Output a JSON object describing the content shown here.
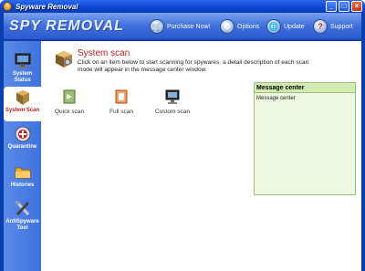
{
  "window": {
    "title": "Spyware Removal",
    "app_icon_glyph": "S",
    "minimize": "_",
    "maximize": "□",
    "close": "×"
  },
  "header": {
    "logo": "SPY REMOVAL",
    "buttons": [
      {
        "label": "Purchase Now!",
        "icon": "cart-icon"
      },
      {
        "label": "Options",
        "icon": "options-icon"
      },
      {
        "label": "Update",
        "icon": "update-icon"
      },
      {
        "label": "Support",
        "icon": "help-icon"
      }
    ]
  },
  "sidebar": {
    "items": [
      {
        "label": "System Status",
        "icon": "monitor-icon",
        "active": false
      },
      {
        "label": "System Scan",
        "icon": "scan-icon",
        "active": true
      },
      {
        "label": "Quarantine",
        "icon": "quarantine-icon",
        "active": false
      },
      {
        "label": "Histories",
        "icon": "folder-icon",
        "active": false
      },
      {
        "label": "AntiSpyware Tool",
        "icon": "tools-icon",
        "active": false
      }
    ]
  },
  "main": {
    "title": "System scan",
    "description": "Click on an item below to start scanning for spywares. a detail description of each scan mode will appear in the message center window.",
    "scan_options": [
      {
        "label": "Quick scan",
        "icon": "quick-scan-icon"
      },
      {
        "label": "Full scan",
        "icon": "full-scan-icon"
      },
      {
        "label": "Custom scan",
        "icon": "custom-scan-icon"
      }
    ],
    "message_center": {
      "header": "Message center",
      "body": "Message center"
    }
  },
  "colors": {
    "accent": "#0a3fb0",
    "title_red": "#c02020",
    "message_bg": "#eef8e0"
  }
}
